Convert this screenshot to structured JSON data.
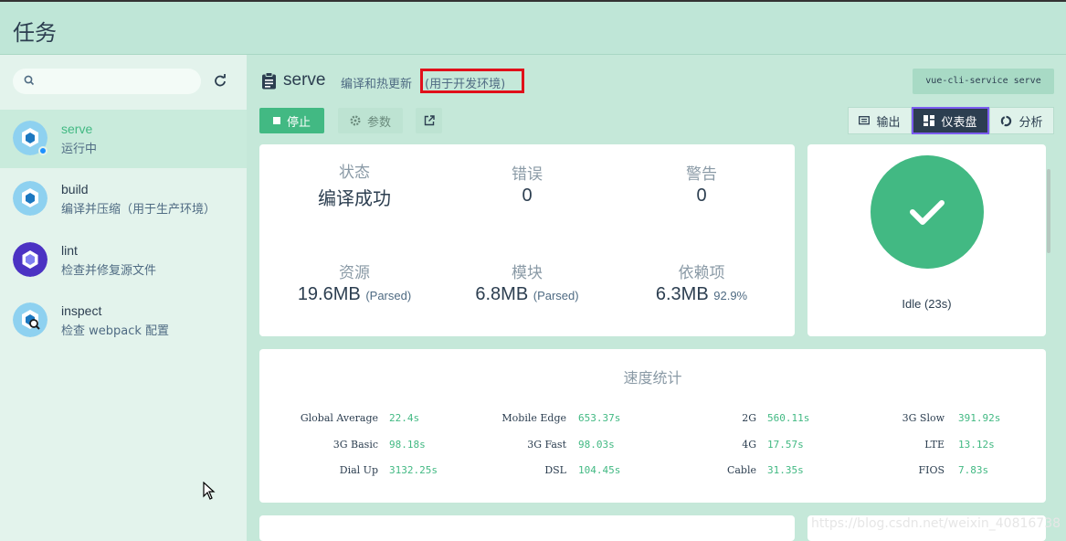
{
  "app": {
    "title": "任务"
  },
  "sidebar": {
    "tasks": [
      {
        "name": "serve",
        "desc": "运行中"
      },
      {
        "name": "build",
        "desc": "编译并压缩（用于生产环境）"
      },
      {
        "name": "lint",
        "desc": "检查并修复源文件"
      },
      {
        "name": "inspect",
        "desc": "检查 webpack 配置"
      }
    ]
  },
  "header": {
    "name": "serve",
    "desc": "编译和热更新",
    "env": "(用于开发环境)",
    "command": "vue-cli-service serve"
  },
  "toolbar": {
    "stop": "停止",
    "params": "参数",
    "output": "输出",
    "dashboard": "仪表盘",
    "analyze": "分析"
  },
  "stats": {
    "status_label": "状态",
    "status_value": "编译成功",
    "errors_label": "错误",
    "errors_value": "0",
    "warnings_label": "警告",
    "warnings_value": "0",
    "assets_label": "资源",
    "assets_value": "19.6MB",
    "assets_note": "(Parsed)",
    "modules_label": "模块",
    "modules_value": "6.8MB",
    "modules_note": "(Parsed)",
    "deps_label": "依赖项",
    "deps_value": "6.3MB",
    "deps_note": "92.9%"
  },
  "status_card": {
    "text": "Idle (23s)",
    "color": "#42b983"
  },
  "speed": {
    "title": "速度统计",
    "items": [
      {
        "label": "Global Average",
        "value": "22.4s"
      },
      {
        "label": "Mobile Edge",
        "value": "653.37s"
      },
      {
        "label": "2G",
        "value": "560.11s"
      },
      {
        "label": "3G Slow",
        "value": "391.92s"
      },
      {
        "label": "3G Basic",
        "value": "98.18s"
      },
      {
        "label": "3G Fast",
        "value": "98.03s"
      },
      {
        "label": "4G",
        "value": "17.57s"
      },
      {
        "label": "LTE",
        "value": "13.12s"
      },
      {
        "label": "Dial Up",
        "value": "3132.25s"
      },
      {
        "label": "DSL",
        "value": "104.45s"
      },
      {
        "label": "Cable",
        "value": "31.35s"
      },
      {
        "label": "FIOS",
        "value": "7.83s"
      }
    ]
  },
  "watermark": "https://blog.csdn.net/weixin_40816738"
}
